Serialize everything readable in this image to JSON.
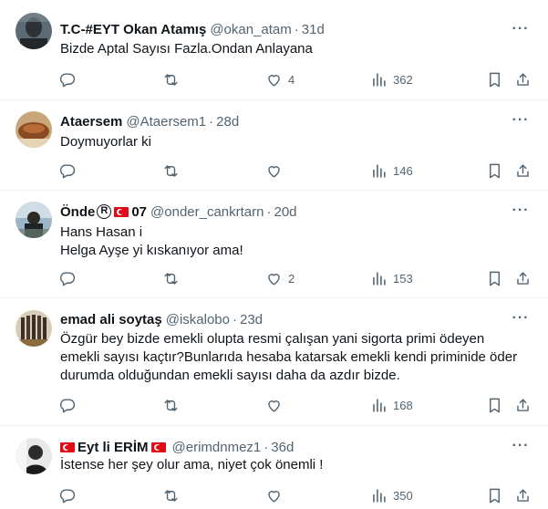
{
  "tweets": [
    {
      "name": "T.C-#EYT Okan Atamış",
      "handle": "@okan_atam",
      "time": "31d",
      "lines": [
        "Bizde Aptal Sayısı Fazla.Ondan Anlayana"
      ],
      "replies": "",
      "retweets": "",
      "likes": "4",
      "views": "362"
    },
    {
      "name": "Ataersem",
      "handle": "@Ataersem1",
      "time": "28d",
      "lines": [
        "Doymuyorlar ki"
      ],
      "replies": "",
      "retweets": "",
      "likes": "",
      "views": "146"
    },
    {
      "name": "Önde",
      "name_suffix": "07",
      "handle": "@onder_cankrtarn",
      "time": "20d",
      "lines": [
        "Hans Hasan i",
        "Helga Ayşe yi kıskanıyor ama!"
      ],
      "replies": "",
      "retweets": "",
      "likes": "2",
      "views": "153"
    },
    {
      "name": "emad ali soytaş",
      "handle": "@iskalobo",
      "time": "23d",
      "lines": [
        "Özgür bey bizde emekli olupta resmi çalışan yani sigorta primi ödeyen",
        "emekli sayısı kaçtır?Bunlarıda hesaba katarsak emekli kendi priminide öder",
        "durumda olduğundan emekli sayısı daha da azdır bizde."
      ],
      "replies": "",
      "retweets": "",
      "likes": "",
      "views": "168"
    },
    {
      "name": "Eyt li ERİM",
      "handle": "@erimdnmez1",
      "time": "36d",
      "lines": [
        "İstense her şey olur ama, niyet çok önemli !"
      ],
      "replies": "",
      "retweets": "",
      "likes": "",
      "views": "350"
    }
  ],
  "separator": "·",
  "more_glyph": "···",
  "colors": {
    "text_primary": "#0f1419",
    "text_secondary": "#536471",
    "divider": "#eff3f4",
    "flag_red": "#e30a17"
  },
  "icons": [
    "reply-icon",
    "retweet-icon",
    "like-icon",
    "views-icon",
    "bookmark-icon",
    "share-icon",
    "more-icon",
    "turkish-flag-icon",
    "registered-icon"
  ]
}
